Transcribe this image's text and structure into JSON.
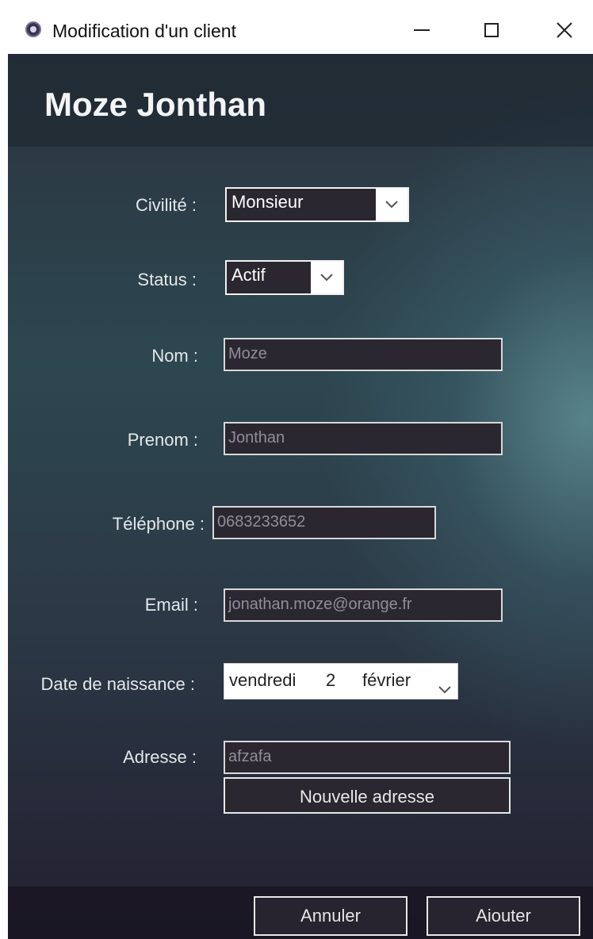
{
  "window": {
    "title": "Modification d'un client",
    "app_icon": "app-icon"
  },
  "header": {
    "title": "Moze Jonthan"
  },
  "form": {
    "civility": {
      "label": "Civilité :",
      "value": "Monsieur"
    },
    "status": {
      "label": "Status :",
      "value": "Actif"
    },
    "last_name": {
      "label": "Nom :",
      "value": "Moze"
    },
    "first_name": {
      "label": "Prenom :",
      "value": "Jonthan"
    },
    "phone": {
      "label": "Téléphone :",
      "value": "0683233652"
    },
    "email": {
      "label": "Email :",
      "value": "jonathan.moze@orange.fr"
    },
    "birth_date": {
      "label": "Date de naissance :",
      "weekday": "vendredi",
      "day": "2",
      "month": "février"
    },
    "address": {
      "label": "Adresse :",
      "value": "afzafa",
      "new_button": "Nouvelle adresse"
    }
  },
  "footer": {
    "cancel_label": "Annuler",
    "add_label": "Aiouter"
  },
  "colors": {
    "panel_dark": "#2a2730",
    "background_teal": "#2d4750",
    "text_light": "#e4e8ea"
  }
}
